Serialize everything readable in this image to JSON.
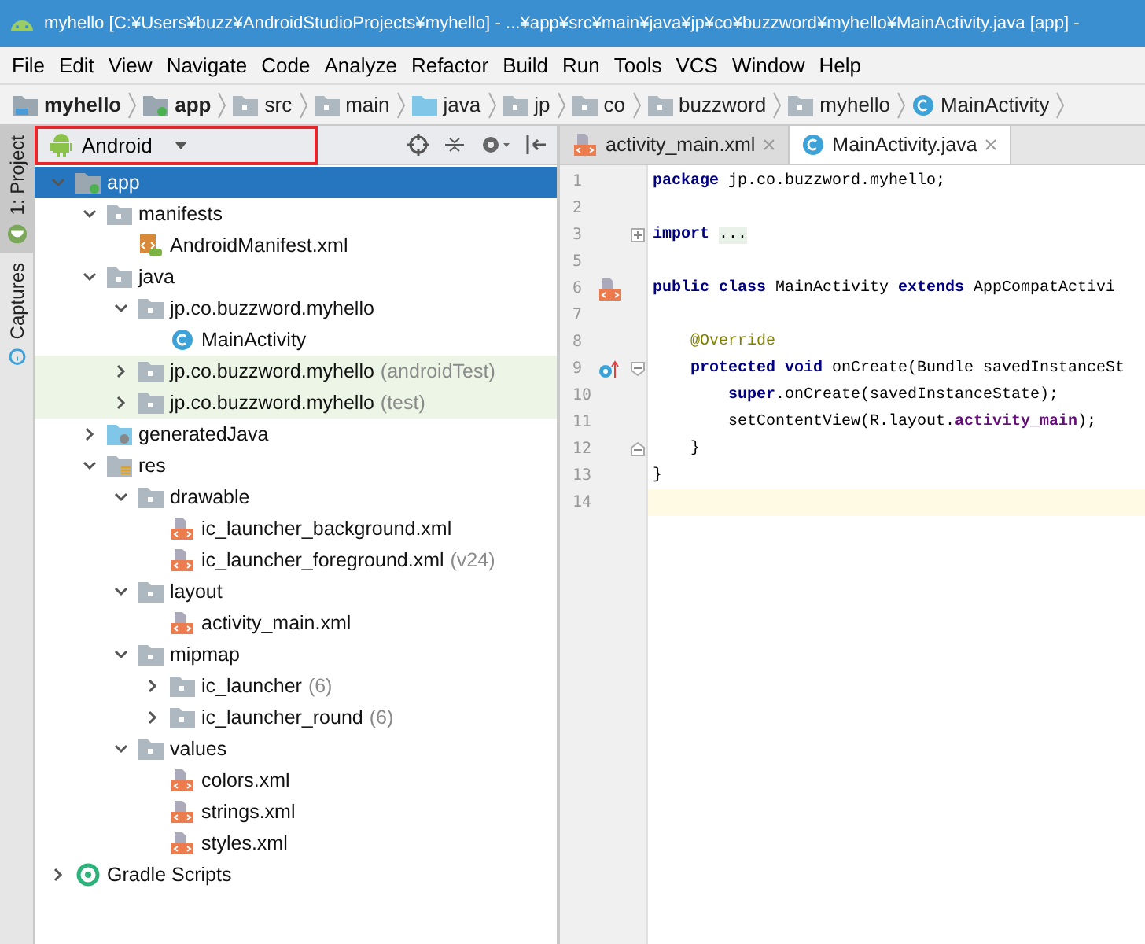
{
  "window": {
    "title": "myhello [C:¥Users¥buzz¥AndroidStudioProjects¥myhello] - ...¥app¥src¥main¥java¥jp¥co¥buzzword¥myhello¥MainActivity.java [app] -"
  },
  "menu": [
    "File",
    "Edit",
    "View",
    "Navigate",
    "Code",
    "Analyze",
    "Refactor",
    "Build",
    "Run",
    "Tools",
    "VCS",
    "Window",
    "Help"
  ],
  "breadcrumb": [
    {
      "kind": "project",
      "label": "myhello"
    },
    {
      "kind": "module",
      "label": "app"
    },
    {
      "kind": "folder",
      "label": "src"
    },
    {
      "kind": "folder",
      "label": "main"
    },
    {
      "kind": "source",
      "label": "java"
    },
    {
      "kind": "package",
      "label": "jp"
    },
    {
      "kind": "package",
      "label": "co"
    },
    {
      "kind": "package",
      "label": "buzzword"
    },
    {
      "kind": "package",
      "label": "myhello"
    },
    {
      "kind": "class",
      "label": "MainActivity"
    }
  ],
  "side_tabs": [
    {
      "label": "1: Project",
      "selected": true
    },
    {
      "label": "Captures",
      "selected": false
    }
  ],
  "project_panel": {
    "view": "Android",
    "outlined": true
  },
  "tree": [
    {
      "kind": "module",
      "label": "app",
      "selected": true,
      "expanded": true,
      "children": [
        {
          "kind": "folder",
          "label": "manifests",
          "selected": false,
          "expanded": true,
          "children": [
            {
              "kind": "manifest",
              "label": "AndroidManifest.xml",
              "selected": false
            }
          ]
        },
        {
          "kind": "folder",
          "label": "java",
          "selected": false,
          "expanded": true,
          "children": [
            {
              "kind": "package",
              "label": "jp.co.buzzword.myhello",
              "selected": false,
              "expanded": true,
              "children": [
                {
                  "kind": "class",
                  "label": "MainActivity",
                  "selected": false
                }
              ]
            },
            {
              "kind": "test-package",
              "label": "jp.co.buzzword.myhello",
              "hint": "(androidTest)",
              "selected": false,
              "expanded": false
            },
            {
              "kind": "test-package",
              "label": "jp.co.buzzword.myhello",
              "hint": "(test)",
              "selected": false,
              "expanded": false
            }
          ]
        },
        {
          "kind": "generated",
          "label": "generatedJava",
          "selected": false,
          "expanded": false
        },
        {
          "kind": "res",
          "label": "res",
          "selected": false,
          "expanded": true,
          "children": [
            {
              "kind": "package",
              "label": "drawable",
              "selected": false,
              "expanded": true,
              "children": [
                {
                  "kind": "xml",
                  "label": "ic_launcher_background.xml",
                  "selected": false
                },
                {
                  "kind": "xml",
                  "label": "ic_launcher_foreground.xml",
                  "hint": "(v24)",
                  "selected": false
                }
              ]
            },
            {
              "kind": "package",
              "label": "layout",
              "selected": false,
              "expanded": true,
              "children": [
                {
                  "kind": "xml",
                  "label": "activity_main.xml",
                  "selected": false
                }
              ]
            },
            {
              "kind": "package",
              "label": "mipmap",
              "selected": false,
              "expanded": true,
              "children": [
                {
                  "kind": "package",
                  "label": "ic_launcher",
                  "hint": "(6)",
                  "selected": false,
                  "expanded": false
                },
                {
                  "kind": "package",
                  "label": "ic_launcher_round",
                  "hint": "(6)",
                  "selected": false,
                  "expanded": false
                }
              ]
            },
            {
              "kind": "package",
              "label": "values",
              "selected": false,
              "expanded": true,
              "children": [
                {
                  "kind": "xml",
                  "label": "colors.xml",
                  "selected": false
                },
                {
                  "kind": "xml",
                  "label": "strings.xml",
                  "selected": false
                },
                {
                  "kind": "xml",
                  "label": "styles.xml",
                  "selected": false
                }
              ]
            }
          ]
        }
      ]
    },
    {
      "kind": "gradle",
      "label": "Gradle Scripts",
      "selected": false,
      "expanded": false
    }
  ],
  "editor_tabs": [
    {
      "kind": "xml",
      "label": "activity_main.xml",
      "selected": false
    },
    {
      "kind": "class",
      "label": "MainActivity.java",
      "selected": true
    }
  ],
  "code": [
    {
      "number": "1",
      "current": false,
      "tokens": [
        {
          "kind": "keyword",
          "text": "package"
        },
        {
          "kind": "plain",
          "text": " jp.co.buzzword.myhello;"
        }
      ]
    },
    {
      "number": "2",
      "current": false
    },
    {
      "number": "3",
      "current": false,
      "fold": {
        "kind": "expand"
      },
      "tokens": [
        {
          "kind": "keyword",
          "text": "import "
        },
        {
          "kind": "folded",
          "text": "..."
        }
      ]
    },
    {
      "number": "5",
      "current": false
    },
    {
      "number": "6",
      "current": false,
      "marker": {
        "kind": "layout"
      },
      "tokens": [
        {
          "kind": "keyword",
          "text": "public class"
        },
        {
          "kind": "plain",
          "text": " MainActivity "
        },
        {
          "kind": "keyword",
          "text": "extends"
        },
        {
          "kind": "plain",
          "text": " AppCompatActivi"
        }
      ]
    },
    {
      "number": "7",
      "current": false
    },
    {
      "number": "8",
      "current": false,
      "tokens": [
        {
          "kind": "annotation",
          "text": "    @Override"
        }
      ]
    },
    {
      "number": "9",
      "current": false,
      "marker": {
        "kind": "override"
      },
      "fold": {
        "kind": "start"
      },
      "tokens": [
        {
          "kind": "keyword",
          "text": "    protected void"
        },
        {
          "kind": "plain",
          "text": " onCreate(Bundle savedInstanceSt"
        }
      ]
    },
    {
      "number": "10",
      "current": false,
      "tokens": [
        {
          "kind": "keyword",
          "text": "        super"
        },
        {
          "kind": "plain",
          "text": ".onCreate(savedInstanceState);"
        }
      ]
    },
    {
      "number": "11",
      "current": false,
      "tokens": [
        {
          "kind": "plain",
          "text": "        setContentView(R.layout."
        },
        {
          "kind": "field",
          "text": "activity_main"
        },
        {
          "kind": "plain",
          "text": ");"
        }
      ]
    },
    {
      "number": "12",
      "current": false,
      "fold": {
        "kind": "end"
      },
      "tokens": [
        {
          "kind": "plain",
          "text": "    }"
        }
      ]
    },
    {
      "number": "13",
      "current": false,
      "tokens": [
        {
          "kind": "plain",
          "text": "}"
        }
      ]
    },
    {
      "number": "14",
      "current": true
    }
  ]
}
